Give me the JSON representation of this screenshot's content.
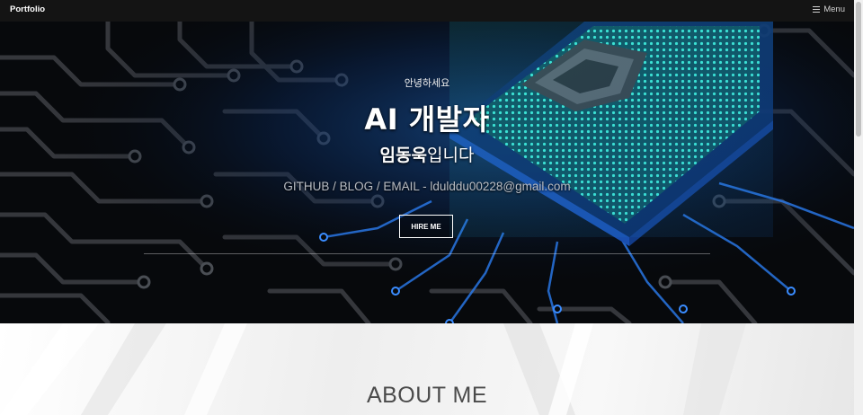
{
  "navbar": {
    "brand": "Portfolio",
    "menu_label": "Menu",
    "menu_icon": "hamburger-icon"
  },
  "hero": {
    "greeting": "안녕하세요",
    "title": "AI 개발자",
    "name": "임동욱",
    "name_suffix": "입니다",
    "contact": "GITHUB / BLOG / EMAIL - ldulddu00228@gmail.com",
    "button_label": "HIRE ME",
    "background_image": "circuit-board-cpu-image"
  },
  "about": {
    "title": "ABOUT ME"
  },
  "colors": {
    "navbar_bg": "#141414",
    "accent_blue": "#1e6bff",
    "accent_cyan": "#2fe0d0"
  }
}
